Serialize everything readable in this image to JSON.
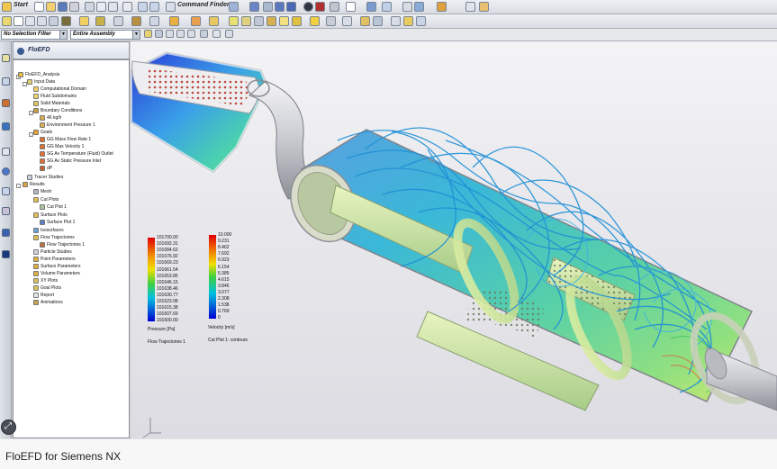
{
  "toolbar": {
    "start_label": "Start",
    "command_finder_label": "Command Finder",
    "selection_filter": "No Selection Filter",
    "assembly_scope": "Entire Assembly"
  },
  "navigator": {
    "title": "FloEFD",
    "tree": [
      {
        "label": "FloEFD_Analysis",
        "level": 0,
        "icon": "analysis-icon"
      },
      {
        "label": "Input Data",
        "level": 1,
        "icon": "input-data-icon"
      },
      {
        "label": "Computational Domain",
        "level": 2,
        "icon": "domain-icon"
      },
      {
        "label": "Fluid Subdomains",
        "level": 2,
        "icon": "fluid-icon"
      },
      {
        "label": "Solid Materials",
        "level": 2,
        "icon": "solid-icon"
      },
      {
        "label": "Boundary Conditions",
        "level": 2,
        "icon": "bc-icon"
      },
      {
        "label": "46 kg/h",
        "level": 3,
        "icon": "bc-item-icon"
      },
      {
        "label": "Environment Pressure 1",
        "level": 3,
        "icon": "bc-item-icon"
      },
      {
        "label": "Goals",
        "level": 2,
        "icon": "goals-icon"
      },
      {
        "label": "GG Mass Flow Rate 1",
        "level": 3,
        "icon": "goal-icon"
      },
      {
        "label": "GG Max Velocity 1",
        "level": 3,
        "icon": "goal-icon"
      },
      {
        "label": "SG Av Temperature (Fluid) Outlet",
        "level": 3,
        "icon": "goal-icon"
      },
      {
        "label": "SG Av Static Pressure Inlet",
        "level": 3,
        "icon": "goal-icon"
      },
      {
        "label": "dP",
        "level": 3,
        "icon": "goal-icon"
      },
      {
        "label": "Tracer Studies",
        "level": 1,
        "icon": "tracer-icon"
      },
      {
        "label": "Results",
        "level": 0,
        "icon": "results-icon"
      },
      {
        "label": "Mesh",
        "level": 1,
        "icon": "mesh-icon"
      },
      {
        "label": "Cut Plots",
        "level": 1,
        "icon": "cut-plot-icon"
      },
      {
        "label": "Cut Plot 1",
        "level": 2,
        "icon": "cut-plot-item-icon"
      },
      {
        "label": "Surface Plots",
        "level": 1,
        "icon": "surface-plot-icon"
      },
      {
        "label": "Surface Plot 1",
        "level": 2,
        "icon": "surface-plot-item-icon"
      },
      {
        "label": "Isosurfaces",
        "level": 1,
        "icon": "isosurface-icon"
      },
      {
        "label": "Flow Trajectories",
        "level": 1,
        "icon": "flow-trajectory-icon"
      },
      {
        "label": "Flow Trajectories 1",
        "level": 2,
        "icon": "flow-trajectory-item-icon"
      },
      {
        "label": "Particle Studies",
        "level": 1,
        "icon": "particle-icon"
      },
      {
        "label": "Point Parameters",
        "level": 1,
        "icon": "point-param-icon"
      },
      {
        "label": "Surface Parameters",
        "level": 1,
        "icon": "surface-param-icon"
      },
      {
        "label": "Volume Parameters",
        "level": 1,
        "icon": "volume-param-icon"
      },
      {
        "label": "XY Plots",
        "level": 1,
        "icon": "xy-plot-icon"
      },
      {
        "label": "Goal Plots",
        "level": 1,
        "icon": "goal-plot-icon"
      },
      {
        "label": "Report",
        "level": 1,
        "icon": "report-icon"
      },
      {
        "label": "Animations",
        "level": 1,
        "icon": "animation-icon"
      }
    ]
  },
  "pressure_legend": {
    "values": [
      "101700.00",
      "101692.31",
      "101684.62",
      "101676.92",
      "101669.23",
      "101661.54",
      "101653.85",
      "101646.15",
      "101638.46",
      "101630.77",
      "101623.08",
      "101615.38",
      "101607.69",
      "101600.00"
    ],
    "unit_label": "Pressure [Pa]",
    "source_label": "Flow Trajectories 1"
  },
  "velocity_legend": {
    "values": [
      "10.000",
      "9.231",
      "8.462",
      "7.692",
      "6.923",
      "6.154",
      "5.385",
      "4.615",
      "3.846",
      "3.077",
      "2.308",
      "1.538",
      "0.769",
      "0"
    ],
    "unit_label": "Velocity [m/s]",
    "source_label": "Cut Plot 1: contours"
  },
  "caption": "FloEFD for Siemens NX",
  "colors": {
    "accent": "#3a5a90",
    "muffler_shell": "#c8d0c0",
    "streamline": "#1e8fd6"
  }
}
